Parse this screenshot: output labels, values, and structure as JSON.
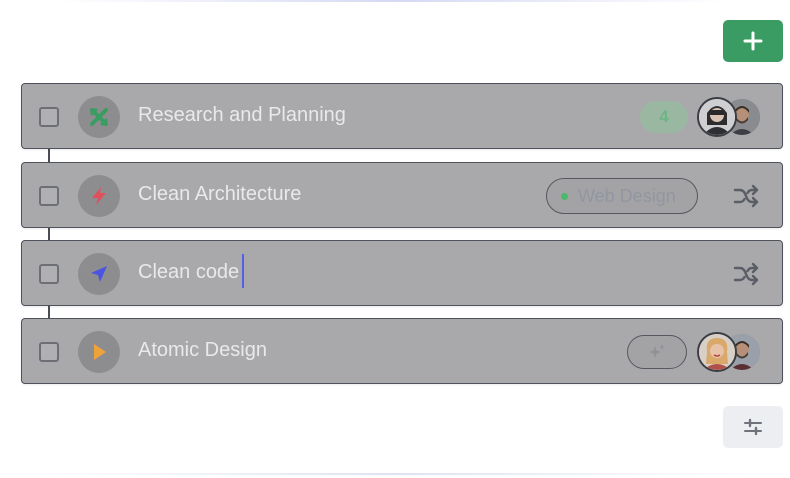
{
  "toolbar": {
    "add_icon": "plus-icon",
    "filter_icon": "sliders-icon"
  },
  "tasks": [
    {
      "title": "Research and Planning",
      "icon": "crossed-arrows-icon",
      "icon_color": "#3a9c62",
      "count": "4",
      "avatars": [
        "avatar-woman-goggles",
        "avatar-man-beard"
      ]
    },
    {
      "title": "Clean Architecture",
      "icon": "bolt-icon",
      "icon_color": "#e0505a",
      "tag": "Web Design",
      "tag_color": "#4bb96a",
      "action_icon": "shuffle-icon"
    },
    {
      "title": "Clean code",
      "icon": "navigation-arrow-icon",
      "icon_color": "#4a55e0",
      "editing": true,
      "action_icon": "shuffle-icon"
    },
    {
      "title": "Atomic Design",
      "icon": "play-icon",
      "icon_color": "#f0a23a",
      "add_tag_icon": "sparkle-icon",
      "avatars": [
        "avatar-woman-blonde",
        "avatar-man-beard"
      ]
    }
  ]
}
